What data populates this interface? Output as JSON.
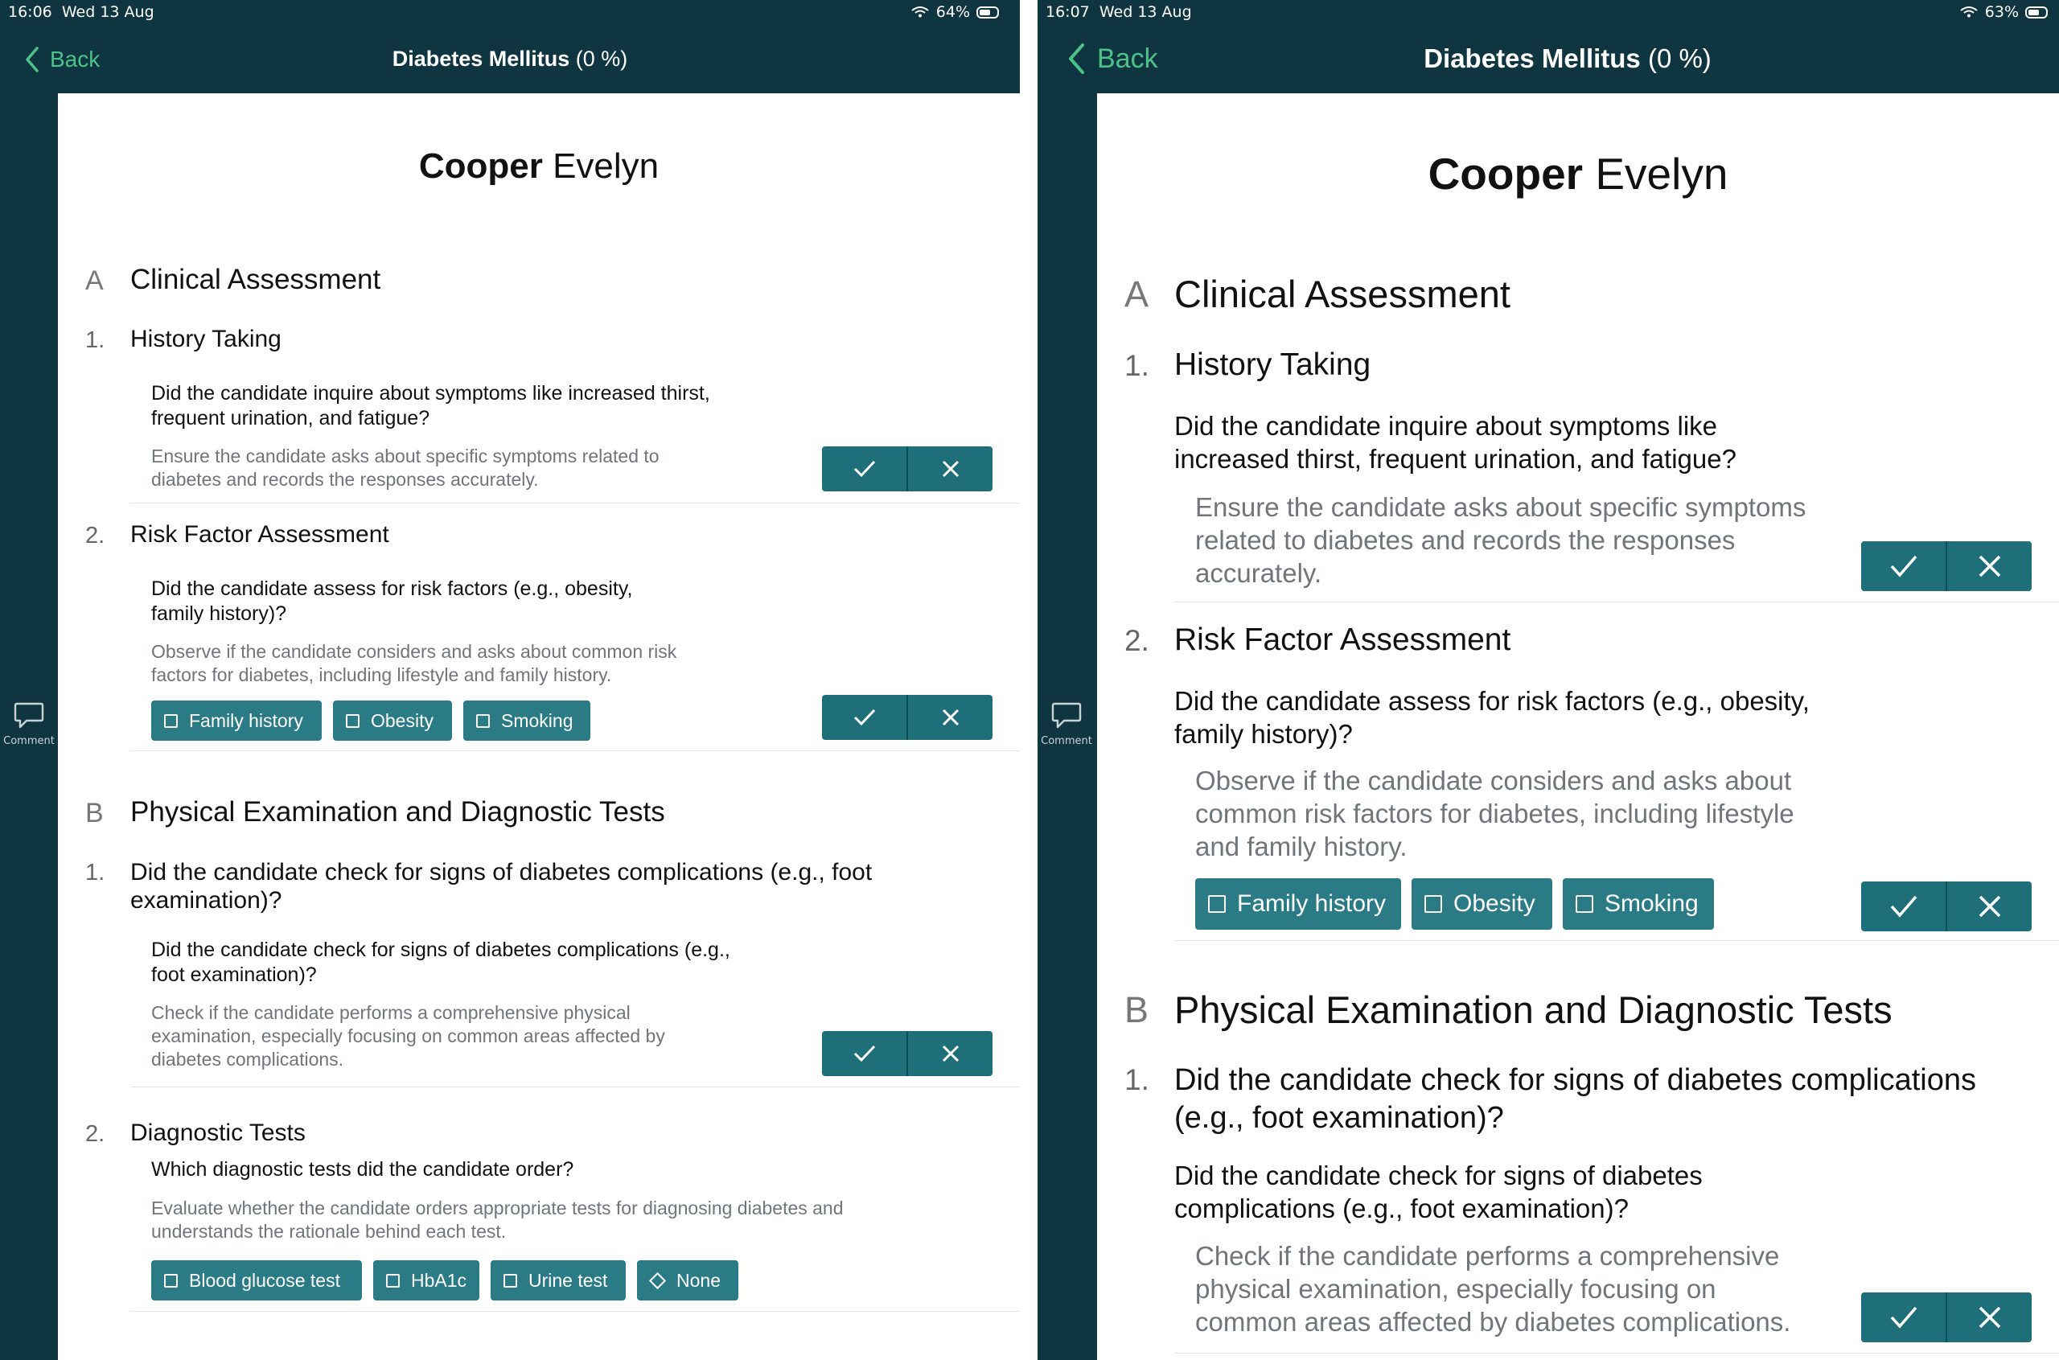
{
  "left": {
    "status": {
      "time": "16:06",
      "date": "Wed 13 Aug",
      "battery": "64%",
      "battery_level": 0.64
    },
    "nav": {
      "back": "Back",
      "title_bold": "Diabetes Mellitus",
      "title_percent": "(0 %)"
    },
    "comment_label": "Comment",
    "student": {
      "last": "Cooper",
      "first": "Evelyn"
    },
    "secA": {
      "letter": "A",
      "title": "Clinical Assessment"
    },
    "a1": {
      "num": "1.",
      "title": "History Taking",
      "q1": "Did the candidate inquire about symptoms like increased thirst,",
      "q2": "frequent urination, and fatigue?",
      "h1": "Ensure the candidate asks about specific symptoms related to",
      "h2": "diabetes and records the responses accurately."
    },
    "a2": {
      "num": "2.",
      "title": "Risk Factor Assessment",
      "q1": "Did the candidate assess for risk factors (e.g., obesity,",
      "q2": "family history)?",
      "h1": "Observe if the candidate considers and asks about common risk",
      "h2": "factors for diabetes, including lifestyle and family history.",
      "chips": [
        "Family history",
        "Obesity",
        "Smoking"
      ]
    },
    "secB": {
      "letter": "B",
      "title": "Physical Examination and Diagnostic Tests"
    },
    "b1": {
      "num": "1.",
      "t1": "Did the candidate check for signs of diabetes complications (e.g., foot",
      "t2": "examination)?",
      "q1": "Did the candidate check for signs of diabetes complications (e.g.,",
      "q2": "foot examination)?",
      "h1": "Check if the candidate performs a comprehensive physical",
      "h2": "examination, especially focusing on common areas affected by",
      "h3": "diabetes complications."
    },
    "b2": {
      "num": "2.",
      "title": "Diagnostic Tests",
      "q1": "Which diagnostic tests did the candidate order?",
      "h1": "Evaluate whether the candidate orders appropriate tests for diagnosing diabetes and",
      "h2": "understands the rationale behind each test.",
      "chips": [
        "Blood glucose test",
        "HbA1c",
        "Urine test"
      ],
      "none": "None"
    }
  },
  "right": {
    "status": {
      "time": "16:07",
      "date": "Wed 13 Aug",
      "battery": "63%",
      "battery_level": 0.63
    },
    "nav": {
      "back": "Back",
      "title_bold": "Diabetes Mellitus",
      "title_percent": "(0 %)"
    },
    "comment_label": "Comment",
    "student": {
      "last": "Cooper",
      "first": "Evelyn"
    },
    "secA": {
      "letter": "A",
      "title": "Clinical Assessment"
    },
    "a1": {
      "num": "1.",
      "title": "History Taking",
      "q1": "Did the candidate inquire about symptoms like",
      "q2": "increased thirst, frequent urination, and fatigue?",
      "h1": "Ensure the candidate asks about specific symptoms",
      "h2": "related to diabetes and records the responses",
      "h3": "accurately."
    },
    "a2": {
      "num": "2.",
      "title": "Risk Factor Assessment",
      "q1": "Did the candidate assess for risk factors (e.g., obesity,",
      "q2": "family history)?",
      "h1": "Observe if the candidate considers and asks about",
      "h2": "common risk factors for diabetes, including lifestyle",
      "h3": "and family history.",
      "chips": [
        "Family history",
        "Obesity",
        "Smoking"
      ]
    },
    "secB": {
      "letter": "B",
      "title": "Physical Examination and Diagnostic Tests"
    },
    "b1": {
      "num": "1.",
      "t1": "Did the candidate check for signs of diabetes complications",
      "t2": "(e.g., foot examination)?",
      "q1": "Did the candidate check for signs of diabetes",
      "q2": "complications (e.g., foot examination)?",
      "h1": "Check if the candidate performs a comprehensive",
      "h2": "physical examination, especially focusing on",
      "h3": "common areas affected by diabetes complications."
    }
  },
  "icons": {
    "check": "checkmark-icon",
    "cross": "cross-icon",
    "comment": "comment-icon",
    "back": "chevron-left-icon",
    "wifi": "wifi-icon",
    "battery": "battery-icon"
  }
}
